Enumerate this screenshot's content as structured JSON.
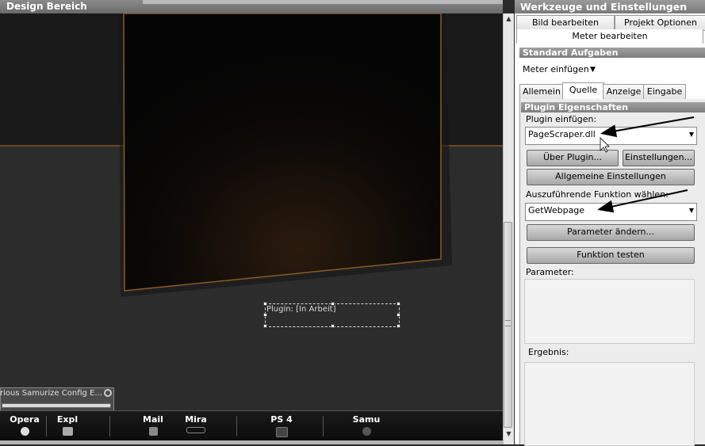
{
  "design": {
    "title": "Design Bereich",
    "plugin_box_text": "Plugin: [In Arbeit]",
    "mini_window_title": "rious Samurize Config E..."
  },
  "taskbar": {
    "items": [
      {
        "label": "Opera",
        "icon": "opera-icon"
      },
      {
        "label": "Expl",
        "icon": "folder-icon"
      },
      {
        "label": "Mail",
        "icon": "mail-icon"
      },
      {
        "label": "Mira",
        "icon": "mira-icon"
      },
      {
        "label": "PS 4",
        "icon": "photoshop-icon"
      },
      {
        "label": "Samu",
        "icon": "samurize-icon"
      }
    ]
  },
  "tools": {
    "title": "Werkzeuge und Einstellungen",
    "tabs": [
      "Bild bearbeiten",
      "Projekt Optionen"
    ],
    "active_tab": "Meter bearbeiten",
    "standard_header": "Standard Aufgaben",
    "meter_einfuegen": "Meter einfügen",
    "subtabs": [
      "Allemein",
      "Quelle",
      "Anzeige",
      "Eingabe"
    ],
    "active_subtab": "Quelle",
    "plugin_header": "Plugin Eigenschaften",
    "plugin_label": "Plugin einfügen:",
    "plugin_value": "PageScraper.dll",
    "about_button": "Über Plugin...",
    "settings_button": "Einstellungen...",
    "general_settings_button": "Allgemeine Einstellungen",
    "function_label": "Auszuführende Funktion wählen:",
    "function_value": "GetWebpage",
    "params_button": "Parameter ändern...",
    "test_button": "Funktion testen",
    "params_label": "Parameter:",
    "result_label": "Ergebnis:"
  },
  "colors": {
    "accent_line": "#6b4a22",
    "panel_header": "#8a8a8a"
  }
}
